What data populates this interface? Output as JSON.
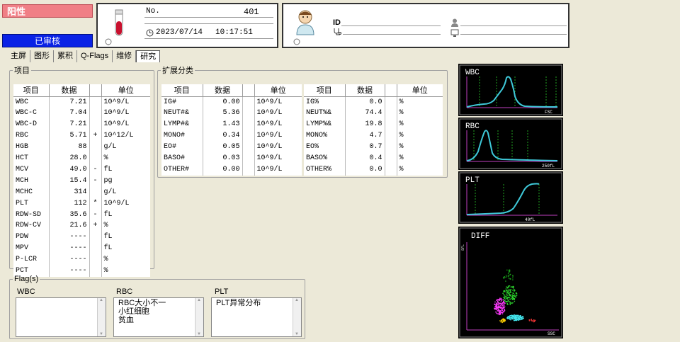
{
  "status": {
    "result": "阳性",
    "review": "已审核"
  },
  "sample": {
    "no_label": "No.",
    "no_value": "401",
    "date": "2023/07/14",
    "time": "10:17:51"
  },
  "patient": {
    "id_label": "ID"
  },
  "tabs": [
    {
      "label": "主屏"
    },
    {
      "label": "图形"
    },
    {
      "label": "累积"
    },
    {
      "label": "Q-Flags"
    },
    {
      "label": "维修"
    },
    {
      "label": "研究",
      "active": true
    }
  ],
  "items": {
    "legend": "项目",
    "headers": [
      "项目",
      "数据",
      "",
      "单位"
    ],
    "rows": [
      [
        "WBC",
        "7.21",
        "",
        "10^9/L"
      ],
      [
        "WBC-C",
        "7.04",
        "",
        "10^9/L"
      ],
      [
        "WBC-D",
        "7.21",
        "",
        "10^9/L"
      ],
      [
        "RBC",
        "5.71",
        "+",
        "10^12/L"
      ],
      [
        "HGB",
        "88",
        "",
        "g/L"
      ],
      [
        "HCT",
        "28.0",
        "",
        "%"
      ],
      [
        "MCV",
        "49.0",
        "-",
        "fL"
      ],
      [
        "MCH",
        "15.4",
        "-",
        "pg"
      ],
      [
        "MCHC",
        "314",
        "",
        "g/L"
      ],
      [
        "PLT",
        "112",
        "*",
        "10^9/L"
      ],
      [
        "RDW-SD",
        "35.6",
        "-",
        "fL"
      ],
      [
        "RDW-CV",
        "21.6",
        "+",
        "%"
      ],
      [
        "PDW",
        "----",
        "",
        "fL"
      ],
      [
        "MPV",
        "----",
        "",
        "fL"
      ],
      [
        "P-LCR",
        "----",
        "",
        "%"
      ],
      [
        "PCT",
        "----",
        "",
        "%"
      ]
    ]
  },
  "extended": {
    "legend": "扩展分类",
    "headers": [
      "项目",
      "数据",
      "",
      "单位"
    ],
    "abs_rows": [
      [
        "IG#",
        "0.00",
        "",
        "10^9/L"
      ],
      [
        "NEUT#&",
        "5.36",
        "",
        "10^9/L"
      ],
      [
        "LYMP#&",
        "1.43",
        "",
        "10^9/L"
      ],
      [
        "MONO#",
        "0.34",
        "",
        "10^9/L"
      ],
      [
        "EO#",
        "0.05",
        "",
        "10^9/L"
      ],
      [
        "BASO#",
        "0.03",
        "",
        "10^9/L"
      ],
      [
        "OTHER#",
        "0.00",
        "",
        "10^9/L"
      ]
    ],
    "pct_rows": [
      [
        "IG%",
        "0.0",
        "",
        "%"
      ],
      [
        "NEUT%&",
        "74.4",
        "",
        "%"
      ],
      [
        "LYMP%&",
        "19.8",
        "",
        "%"
      ],
      [
        "MONO%",
        "4.7",
        "",
        "%"
      ],
      [
        "EO%",
        "0.7",
        "",
        "%"
      ],
      [
        "BASO%",
        "0.4",
        "",
        "%"
      ],
      [
        "OTHER%",
        "0.0",
        "",
        "%"
      ]
    ]
  },
  "flags": {
    "legend": "Flag(s)",
    "wbc_label": "WBC",
    "rbc_label": "RBC",
    "plt_label": "PLT",
    "wbc": [],
    "rbc": [
      "RBC大小不一",
      "小红细胞",
      "贫血"
    ],
    "plt": [
      "PLT异常分布"
    ]
  },
  "graphs": {
    "wbc": {
      "title": "WBC",
      "axis": "FSC"
    },
    "rbc": {
      "title": "RBC",
      "axis": "250fL"
    },
    "plt": {
      "title": "PLT",
      "axis": "40fL"
    },
    "diff": {
      "title": "DIFF",
      "x_axis": "SSC",
      "y_axis": "SFL"
    }
  },
  "colors": {
    "curve": "#3ec8d8",
    "marker": "#1fa01f",
    "axis": "#c040c0",
    "positive": "#f07f86",
    "reviewed": "#0a22e6"
  }
}
